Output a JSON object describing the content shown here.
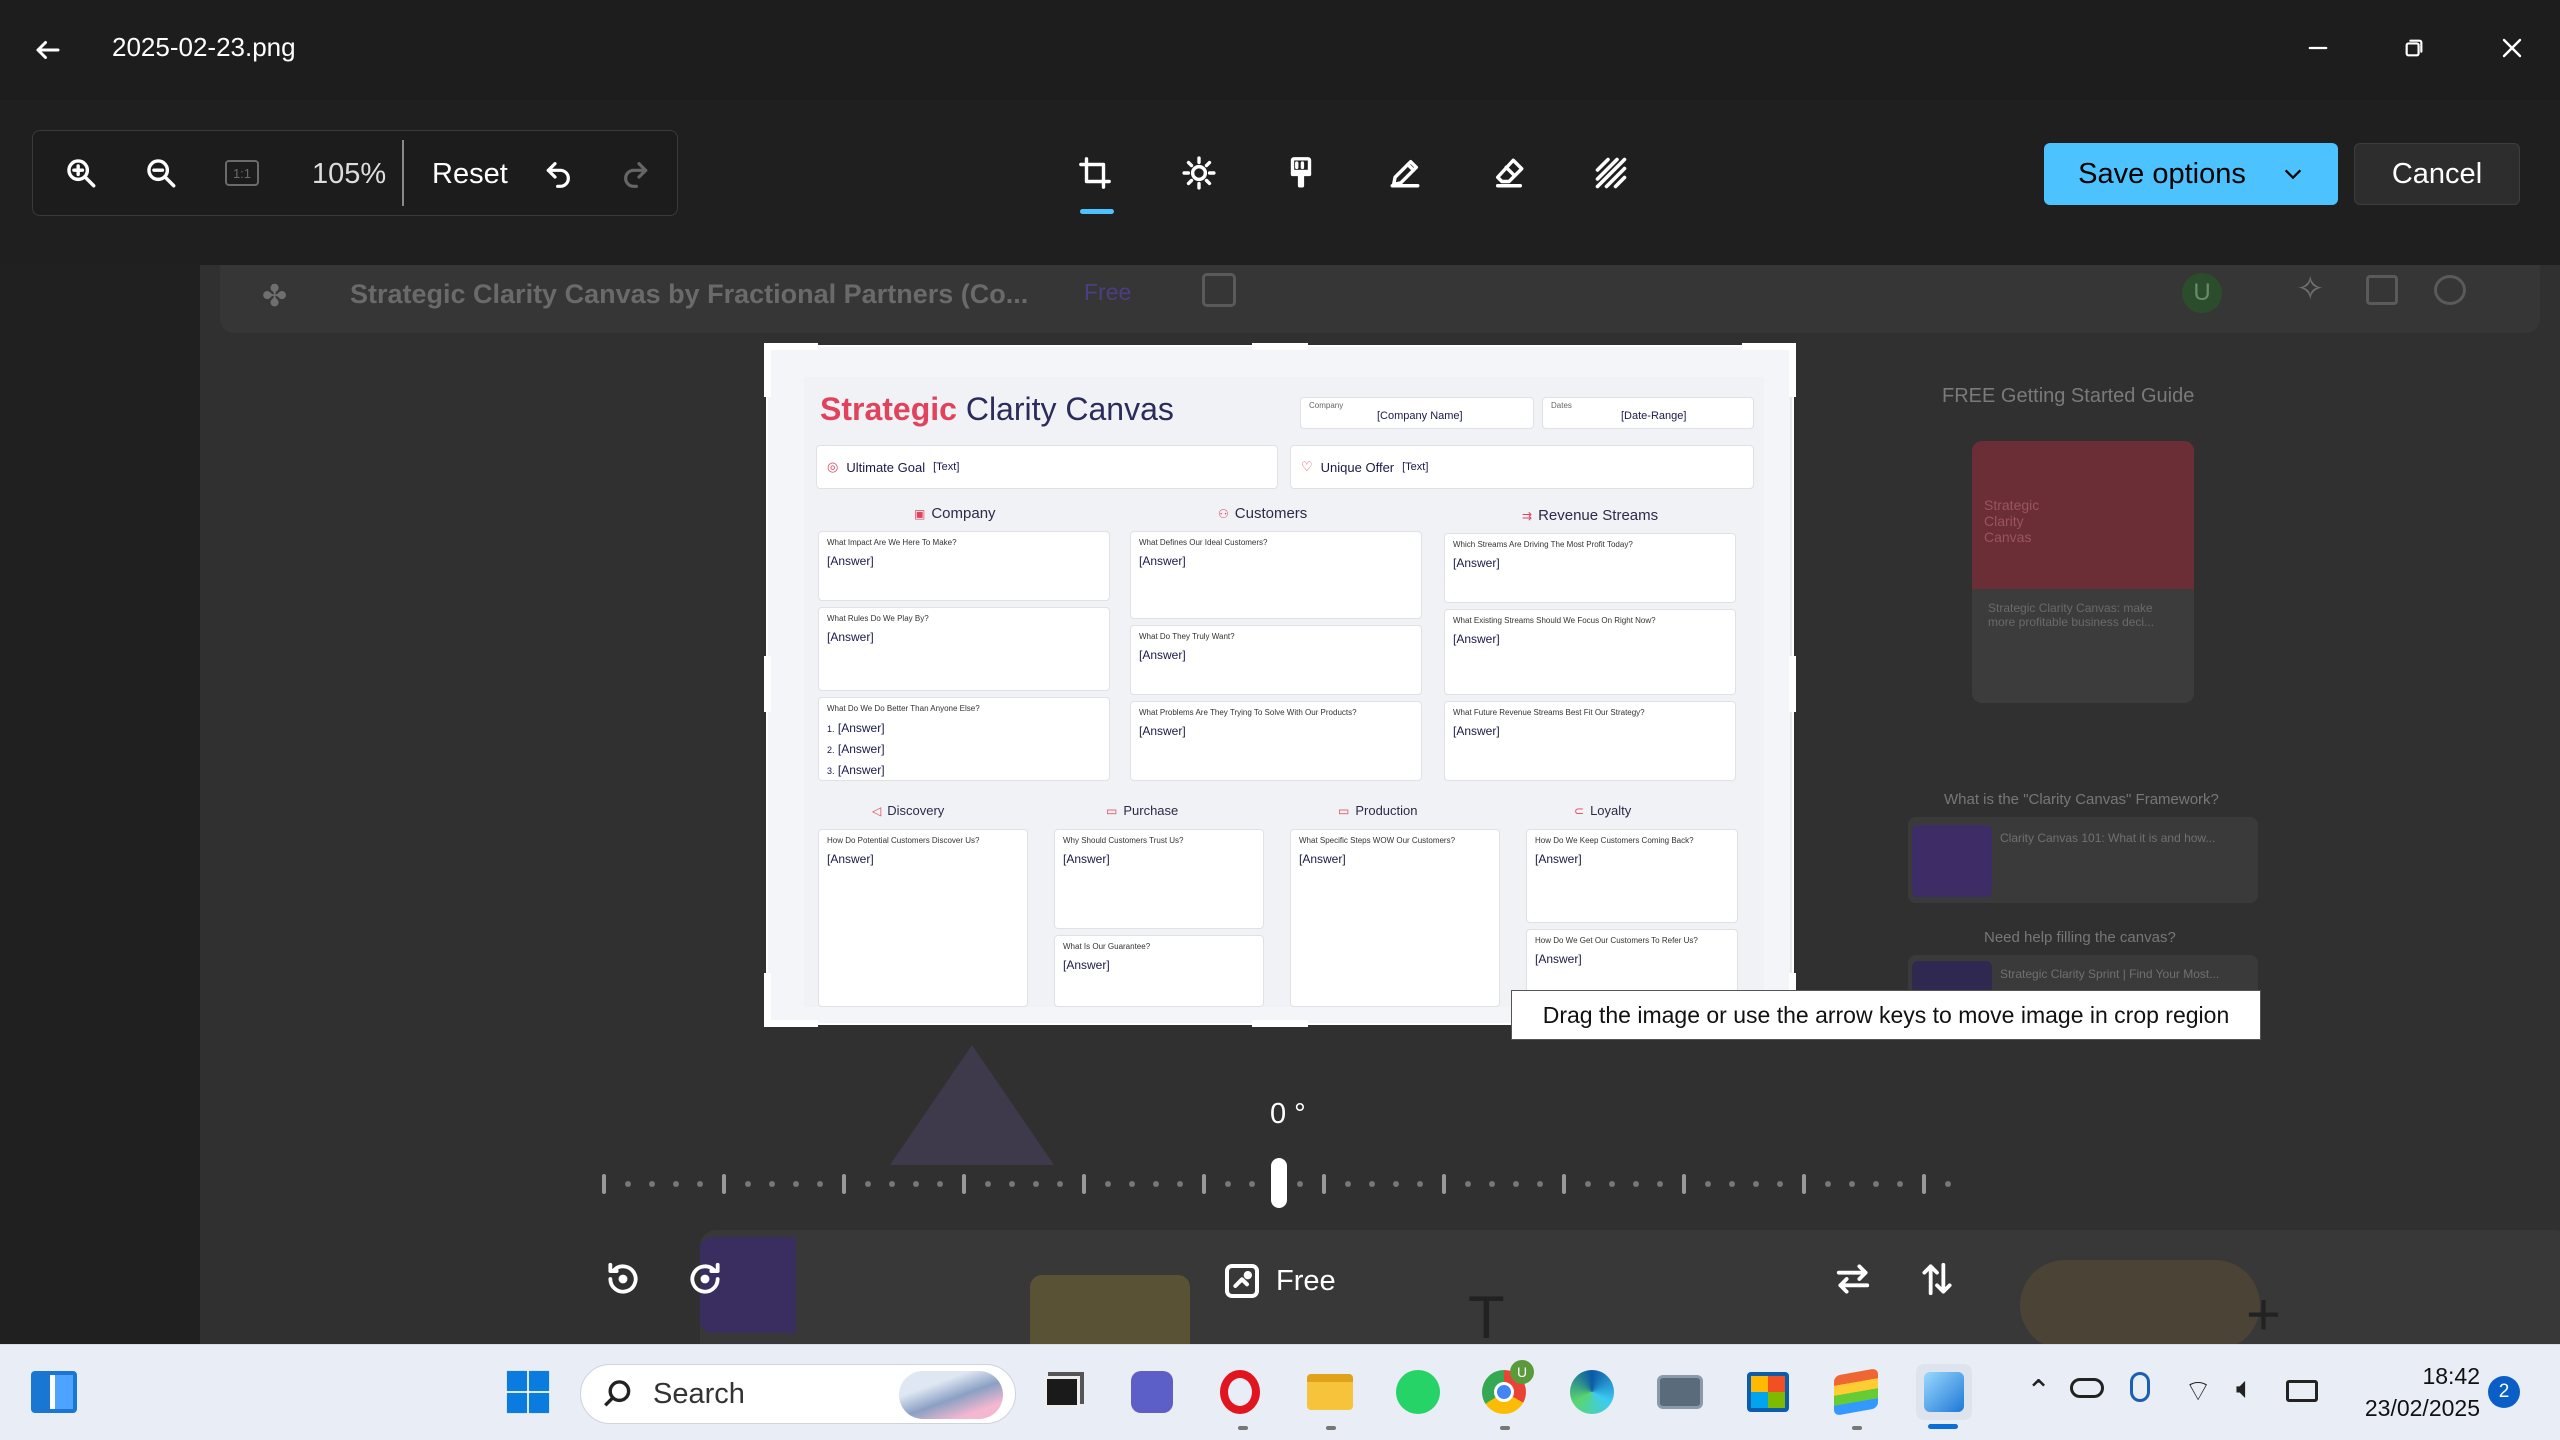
{
  "window": {
    "filename": "2025-02-23.png"
  },
  "zoom": {
    "level": "105%",
    "reset_label": "Reset",
    "actual_size_label": "1:1"
  },
  "actions": {
    "save_label": "Save options",
    "cancel_label": "Cancel"
  },
  "background_app": {
    "file_title": "Strategic Clarity Canvas by Fractional Partners (Co...",
    "badge": "Free",
    "avatar_initial": "U",
    "guide_title": "FREE Getting Started Guide",
    "guide_thumb_text": "Strategic Clarity Canvas",
    "guide_desc": "Strategic Clarity Canvas: make more profitable business deci...",
    "framework_title": "What is the \"Clarity Canvas\" Framework?",
    "framework_item": "Clarity Canvas 101: What it is and how...",
    "help_title": "Need help filling the canvas?",
    "help_item": "Strategic Clarity Sprint | Find Your Most..."
  },
  "canvas_doc": {
    "title_accent": "Strategic",
    "title_rest": "Clarity Canvas",
    "company_label": "Company",
    "company_value": "[Company Name]",
    "dates_label": "Dates",
    "dates_value": "[Date-Range]",
    "goal_label": "Ultimate Goal",
    "goal_value": "[Text]",
    "offer_label": "Unique Offer",
    "offer_value": "[Text]",
    "sections_top": [
      {
        "title": "Company",
        "cards": [
          {
            "q": "What Impact Are We Here To Make?",
            "a": "[Answer]"
          },
          {
            "q": "What Rules Do We Play By?",
            "a": "[Answer]"
          },
          {
            "q": "What Do We Do Better Than Anyone Else?",
            "a": "[Answer]"
          }
        ]
      },
      {
        "title": "Customers",
        "cards": [
          {
            "q": "What Defines Our Ideal Customers?",
            "a": "[Answer]"
          },
          {
            "q": "What Do They Truly Want?",
            "a": "[Answer]"
          },
          {
            "q": "What Problems Are They Trying To Solve With Our Products?",
            "a": "[Answer]"
          }
        ]
      },
      {
        "title": "Revenue Streams",
        "cards": [
          {
            "q": "Which Streams Are Driving The Most Profit Today?",
            "a": "[Answer]"
          },
          {
            "q": "What Existing Streams Should We Focus On Right Now?",
            "a": "[Answer]"
          },
          {
            "q": "What Future Revenue Streams Best Fit Our Strategy?",
            "a": "[Answer]"
          }
        ]
      }
    ],
    "numbered_answers": [
      "1.",
      "2.",
      "3."
    ],
    "sections_bottom": [
      {
        "title": "Discovery",
        "cards": [
          {
            "q": "How Do Potential Customers Discover Us?",
            "a": "[Answer]"
          }
        ]
      },
      {
        "title": "Purchase",
        "cards": [
          {
            "q": "Why Should Customers Trust Us?",
            "a": "[Answer]"
          },
          {
            "q": "What Is Our Guarantee?",
            "a": "[Answer]"
          }
        ]
      },
      {
        "title": "Production",
        "cards": [
          {
            "q": "What Specific Steps WOW Our Customers?",
            "a": "[Answer]"
          }
        ]
      },
      {
        "title": "Loyalty",
        "cards": [
          {
            "q": "How Do We Keep Customers Coming Back?",
            "a": "[Answer]"
          },
          {
            "q": "How Do We Get Our Customers To Refer Us?",
            "a": "[Answer]"
          }
        ]
      }
    ]
  },
  "tooltip": "Drag the image or use the arrow keys to move image in crop region",
  "rotation": {
    "value": "0 °",
    "aspect_label": "Free"
  },
  "taskbar": {
    "search_placeholder": "Search",
    "time": "18:42",
    "date": "23/02/2025",
    "notification_count": "2",
    "chrome_badge": "U"
  },
  "colors": {
    "accent": "#4cc2ff",
    "brand_pink": "#e0435b"
  }
}
